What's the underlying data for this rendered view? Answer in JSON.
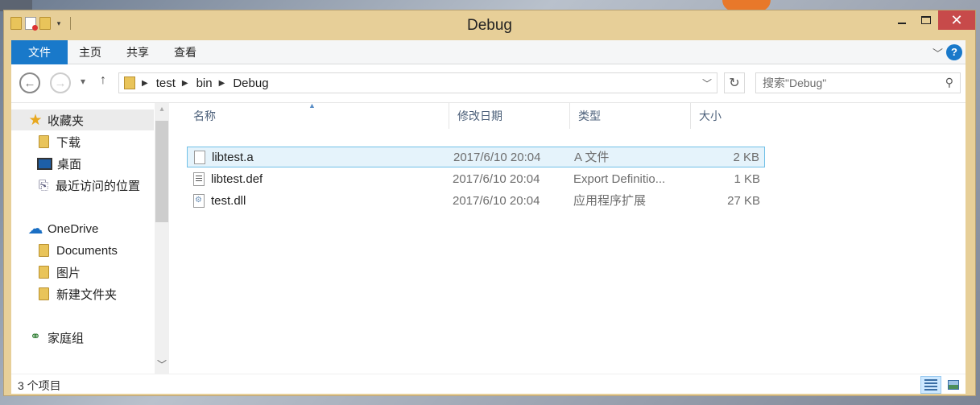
{
  "window": {
    "title": "Debug",
    "close_glyph": "✕"
  },
  "ribbon": {
    "tabs": [
      "文件",
      "主页",
      "共享",
      "查看"
    ],
    "help_glyph": "?"
  },
  "address": {
    "breadcrumbs": [
      "test",
      "bin",
      "Debug"
    ],
    "search_placeholder": "搜索\"Debug\""
  },
  "sidebar": {
    "favorites": "收藏夹",
    "downloads": "下载",
    "desktop": "桌面",
    "recent": "最近访问的位置",
    "onedrive": "OneDrive",
    "documents": "Documents",
    "pictures": "图片",
    "new_folder": "新建文件夹",
    "homegroup": "家庭组"
  },
  "columns": {
    "name": "名称",
    "date": "修改日期",
    "type": "类型",
    "size": "大小"
  },
  "files": [
    {
      "name": "libtest.a",
      "date": "2017/6/10 20:04",
      "type": "A 文件",
      "size": "2 KB",
      "icon": "blank-file-icon",
      "selected": true
    },
    {
      "name": "libtest.def",
      "date": "2017/6/10 20:04",
      "type": "Export Definitio...",
      "size": "1 KB",
      "icon": "text-file-icon",
      "selected": false
    },
    {
      "name": "test.dll",
      "date": "2017/6/10 20:04",
      "type": "应用程序扩展",
      "size": "27 KB",
      "icon": "dll-file-icon",
      "selected": false
    }
  ],
  "status": {
    "item_count": "3 个项目"
  },
  "colors": {
    "titlebar": "#e7cf98",
    "file_tab": "#1979ca",
    "close_button": "#c74a4a",
    "selection_fill": "#e5f3fb",
    "selection_border": "#70c0e7"
  }
}
